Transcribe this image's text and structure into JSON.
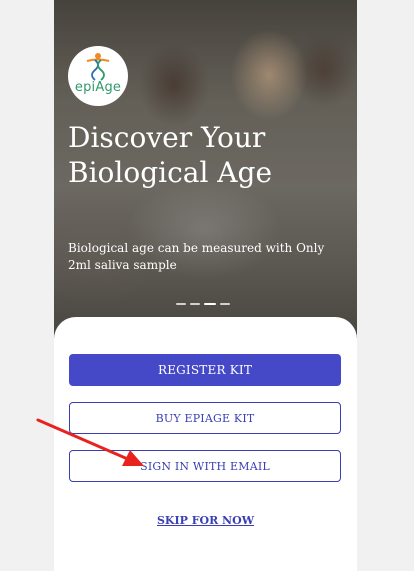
{
  "app": {
    "logo_text": "epiAge"
  },
  "hero": {
    "title": "Discover Your Biological Age",
    "subtitle": "Biological age can be measured with Only 2ml saliva sample",
    "carousel": {
      "slides": 4,
      "active": 3
    }
  },
  "actions": {
    "register_label": "REGISTER KIT",
    "buy_label": "BUY EPIAGE KIT",
    "signin_label": "SIGN IN WITH EMAIL",
    "skip_label": "SKIP FOR NOW"
  },
  "colors": {
    "primary": "#4549c8",
    "outline": "#3a3fb3",
    "arrow": "#e8231f",
    "logo_green": "#2f9a6a"
  },
  "icons": {
    "logo": "dna-person-logo-icon",
    "annotation": "red-arrow-icon"
  }
}
